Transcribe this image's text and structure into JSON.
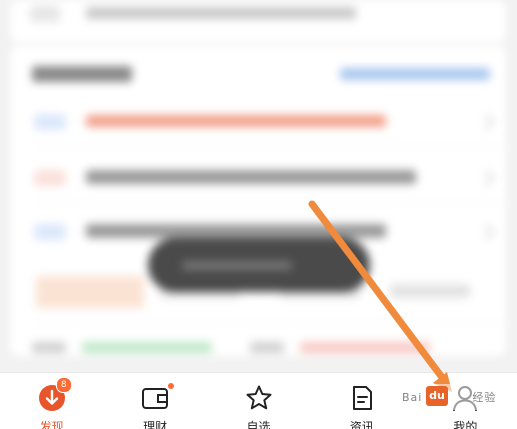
{
  "tabbar": {
    "active_color": "#e8552a",
    "items": [
      {
        "label": "发现",
        "icon": "discover-icon",
        "badge": "8",
        "active": true
      },
      {
        "label": "理财",
        "icon": "wallet-icon",
        "dot": true,
        "active": false
      },
      {
        "label": "自选",
        "icon": "star-icon",
        "active": false
      },
      {
        "label": "资讯",
        "icon": "news-icon",
        "active": false
      },
      {
        "label": "我的",
        "icon": "profile-icon",
        "active": false
      }
    ]
  },
  "watermark": {
    "brand": "Bai",
    "logo": "du",
    "suffix": "经验"
  },
  "annotation": {
    "type": "orange-arrow",
    "points_to": "tab-mine",
    "color": "#f08a3c"
  }
}
